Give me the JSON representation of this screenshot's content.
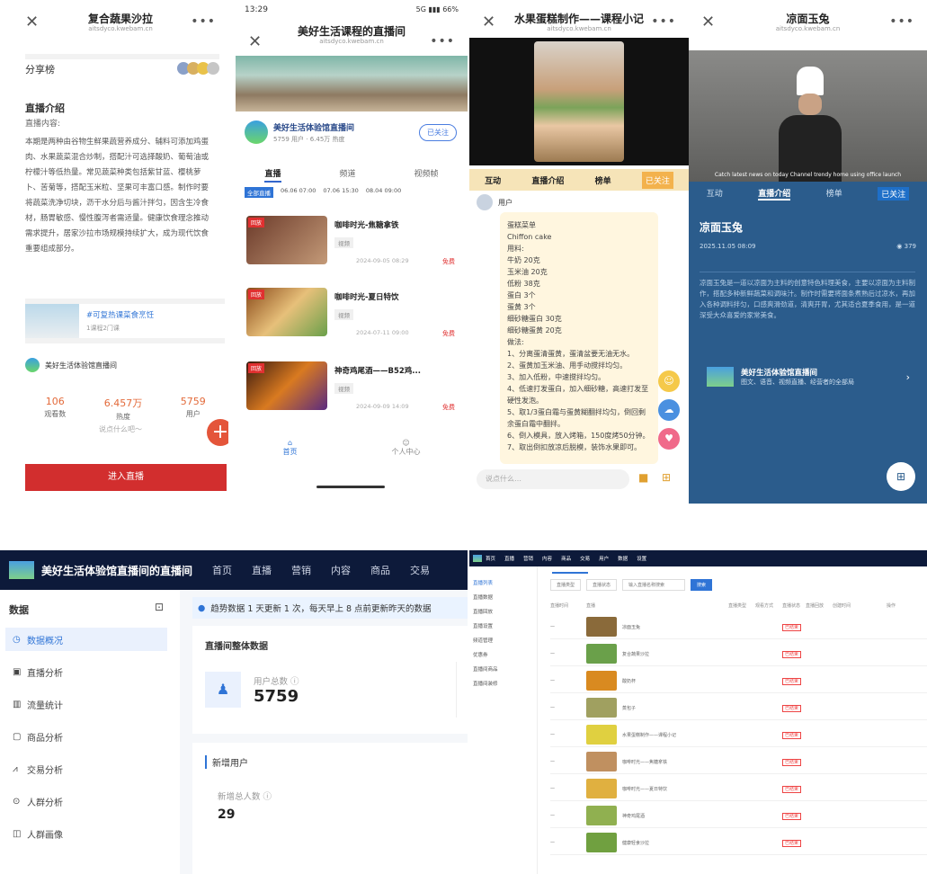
{
  "p1": {
    "title": "复合蔬果沙拉",
    "subtitle": "aitsdyco.kwebam.cn",
    "share_label": "分享榜",
    "intro_heading": "直播介绍",
    "intro_sub": "直播内容:",
    "intro_body": "本期是两种由谷物生鲜果蔬营养成分、辅料可添加鸡蛋肉、水果蔬菜混合炒制，搭配汁可选择酸奶、葡萄油或柠檬汁等低热量。常见蔬菜种类包括紫甘蓝、樱桃萝卜、苦菊等，搭配玉米粒、坚果可丰富口感。制作时要将蔬菜洗净切块，沥干水分后与酱汁拌匀，因含生冷食材，肠胃敏感、慢性腹泻者需适量。健康饮食理念推动需求提升，居家沙拉市场规模持续扩大，成为现代饮食重要组成部分。",
    "course_title": "#可复热课菜食烹饪",
    "course_sub": "1课程2门课",
    "room_name": "美好生活体验馆直播间",
    "stats": [
      {
        "value": "106",
        "label": "观看数"
      },
      {
        "value": "6.457万",
        "label": "热度"
      },
      {
        "value": "5759",
        "label": "用户"
      }
    ],
    "comment_placeholder": "说点什么吧～",
    "plus": "+",
    "enter_button": "进入直播"
  },
  "p2": {
    "time": "13:29",
    "status_icons": "5G ▮▮▮ 66%",
    "title": "美好生活课程的直播间",
    "subtitle": "aitsdyco.kwebam.cn",
    "channel_name": "美好生活体验馆直播间",
    "channel_stats": "5759 用户 · 6.45万 热度",
    "follow": "已关注",
    "tabs": [
      "直播",
      "频道",
      "视频帧"
    ],
    "dates": [
      "全部直播",
      "06.06 07:00",
      "07.06 15:30",
      "08.04 09:00"
    ],
    "items": [
      {
        "title": "咖啡时光-焦糖拿铁",
        "tag": "视频",
        "date": "2024-09-05 08:29",
        "badge": "回放",
        "fee": "免费"
      },
      {
        "title": "咖啡时光-夏日特饮",
        "tag": "视频",
        "date": "2024-07-11 09:00",
        "badge": "回放",
        "fee": "免费"
      },
      {
        "title": "神奇鸡尾酒——B52鸡...",
        "tag": "视频",
        "date": "2024-09-09 14:09",
        "badge": "回放",
        "fee": "免费"
      }
    ],
    "nav": [
      "首页",
      "个人中心"
    ]
  },
  "p3": {
    "title": "水果蛋糕制作——课程小记",
    "subtitle": "aitsdyco.kwebam.cn",
    "tabs": [
      "互动",
      "直播介绍",
      "榜单"
    ],
    "follow": "已关注",
    "username": "用户",
    "message": "蛋糕菜单\nChiffon cake\n用料:\n牛奶 20克\n玉米油 20克\n低粉 38克\n蛋白 3个\n蛋黄 3个\n细砂糖蛋白 30克\n细砂糖蛋黄 20克\n做法:\n1、分离蛋清蛋黄，蛋清盆要无油无水。\n2、蛋黄加玉米油、用手动搅拌均匀。\n3、加入低粉，中速搅拌均匀。\n4、低速打发蛋白，加入细砂糖，高速打发至硬性发泡。\n5、取1/3蛋白霜与蛋黄糊翻拌均匀，倒回剩余蛋白霜中翻拌。\n6、倒入模具，放入烤箱，150度烤50分钟。\n7、取出倒扣放凉后脱模，装饰水果即可。",
    "input_placeholder": "说点什么…",
    "side_icons": [
      "☺",
      "☁",
      "♥"
    ]
  },
  "p4": {
    "title": "凉面玉兔",
    "subtitle": "aitsdyco.kwebam.cn",
    "caption": "Catch latest news on today Channel trendy home using office launch",
    "tabs": [
      "互动",
      "直播介绍",
      "榜单"
    ],
    "follow": "已关注",
    "live_title": "凉面玉兔",
    "date": "2025.11.05 08:09",
    "views": "379",
    "desc": "凉面玉兔是一道以凉面为主料的创意特色料理美食，主要以凉面为主料制作，搭配多种新鲜蔬菜和调味汁。制作时需要将面条煮熟后过凉水，再加入各种调料拌匀，口感爽滑劲道，清爽开胃，尤其适合夏季食用，是一道深受大众喜爱的家常美食。",
    "card_title": "美好生活体验馆直播间",
    "card_sub": "图文、语音、视频直播、经营者的全部局",
    "fab": "⊞"
  },
  "p5": {
    "app_title": "美好生活体验馆直播间的直播间",
    "nav": [
      "首页",
      "直播",
      "营销",
      "内容",
      "商品",
      "交易"
    ],
    "side_heading": "数据",
    "side_items": [
      "数据概况",
      "直播分析",
      "流量统计",
      "商品分析",
      "交易分析",
      "人群分析",
      "人群画像"
    ],
    "notice": "趋势数据 1 天更新 1 次，每天早上 8 点前更新昨天的数据",
    "section_title": "直播间整体数据",
    "total_users_label": "用户总数 ⓘ",
    "total_users": "5759",
    "new_users_section": "新增用户",
    "new_users_label": "新增总人数 ⓘ",
    "new_users": "29"
  },
  "p6": {
    "top_nav": [
      "首页",
      "直播",
      "营销",
      "内容",
      "商品",
      "交易",
      "用户",
      "数据",
      "设置"
    ],
    "side_items": [
      "直播列表",
      "直播数据",
      "直播回放",
      "直播设置",
      "频道管理",
      "优惠券",
      "直播间商品",
      "直播间装修"
    ],
    "filters": [
      "直播类型",
      "直播状态",
      "输入直播名称搜索"
    ],
    "search_btn": "搜索",
    "headers": [
      "直播时间",
      "直播",
      "直播类型",
      "观看方式",
      "直播状态",
      "直播回放",
      "创建时间",
      "操作"
    ],
    "rows": [
      {
        "title": "凉面玉兔",
        "status": "已结束"
      },
      {
        "title": "复合蔬果沙拉",
        "status": "已结束"
      },
      {
        "title": "酸奶杯",
        "status": "已结束"
      },
      {
        "title": "蒸包子",
        "status": "已结束"
      },
      {
        "title": "水果蛋糕制作——课程小记",
        "status": "已结束"
      },
      {
        "title": "咖啡时光——焦糖拿铁",
        "status": "已结束"
      },
      {
        "title": "咖啡时光——夏日特饮",
        "status": "已结束"
      },
      {
        "title": "神奇鸡尾酒",
        "status": "已结束"
      },
      {
        "title": "健康轻食沙拉",
        "status": "已结束"
      }
    ]
  }
}
